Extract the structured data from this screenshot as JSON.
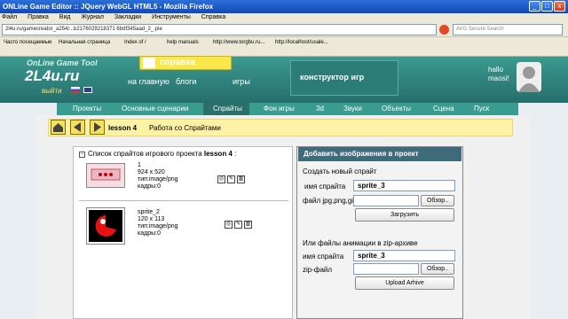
{
  "window": {
    "title": "ONLine Game Editor :: JQuery WebGL HTML5 - Mozilla Firefox"
  },
  "menu": [
    "Файл",
    "Правка",
    "Вид",
    "Журнал",
    "Закладки",
    "Инструменты",
    "Справка"
  ],
  "address": {
    "url": "2l4u.ru/gamecreator_a254/...b2176029218371 6bdf345aad_2_.pie",
    "search_placeholder": "AVG Secure Search"
  },
  "bookmarks": [
    "Часто посещаемые",
    "Начальная страница",
    "Index of /",
    "help manuals",
    "http://www.torgbu.ru...",
    "http://localhost/usale..."
  ],
  "site": {
    "logo_small": "OnLine Game Tool",
    "logo": "2L4u.ru",
    "exit": "выйти",
    "help_tab": "справка",
    "top_nav": [
      "на главную",
      "блоги",
      "игры"
    ],
    "constructor": "конструктор игр",
    "hello": "hallo",
    "user": "maosi!",
    "main_nav": [
      "Проекты",
      "Основные сценарии",
      "Спрайты",
      "Фон игры",
      "3d",
      "Звуки",
      "Объекты",
      "Сцена",
      "Пуск"
    ],
    "active_nav": "Спрайты",
    "breadcrumb": {
      "project": "lesson 4",
      "page": "Работа со Спрайтами"
    }
  },
  "sprites_panel": {
    "title_prefix": "Список спрайтов игрового проекта ",
    "project": "lesson 4",
    "items": [
      {
        "name": "1",
        "size": "924 x 520",
        "type": "тип:image/png",
        "frames": "кадры:0"
      },
      {
        "name": "sprite_2",
        "size": "120 x 113",
        "type": "тип:image/png",
        "frames": "кадры:0"
      }
    ]
  },
  "add_panel": {
    "title": "Добавить изображения в проект",
    "create_label": "Создать новый спрайт",
    "name_label": "имя спрайта",
    "name_value": "sprite_3",
    "file_label": "файл jpg,png,gif",
    "browse": "Обзор..",
    "upload": "Загрузить",
    "or_zip": "Или файлы анимации в zip-архиве",
    "zip_name_label": "имя спрайта",
    "zip_name_value": "sprite_3",
    "zip_file_label": "zip-файл",
    "zip_browse": "Обзор..",
    "upload_arhive": "Upload Arhive"
  },
  "colors": {
    "header": "#2f847d",
    "help": "#fbe64b",
    "panel_head": "#3f6a7a",
    "strip": "#fdf2a5"
  }
}
